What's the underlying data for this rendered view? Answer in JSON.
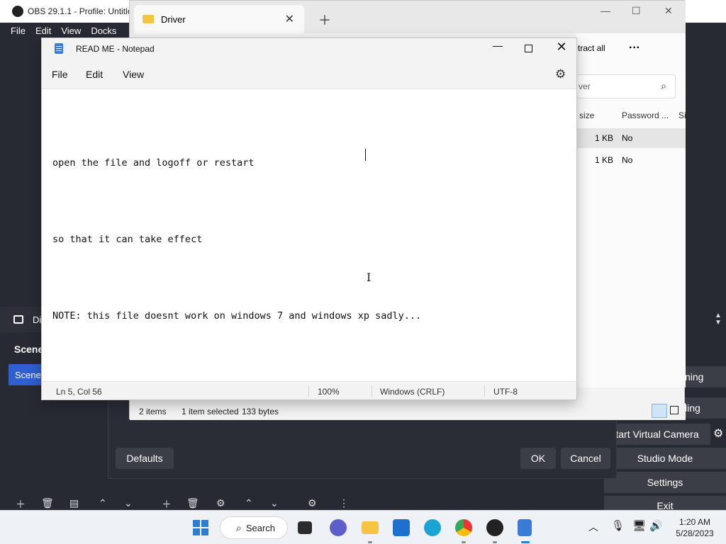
{
  "obs": {
    "title": "OBS 29.1.1 - Profile: Untitle",
    "menu": [
      "File",
      "Edit",
      "View",
      "Docks"
    ],
    "source_label": "Di",
    "scenes_label": "Scene",
    "scene_item": "Scene",
    "controls": {
      "virtual_camera": "tart Virtual Camera",
      "studio_mode": "Studio Mode",
      "settings": "Settings",
      "exit": "Exit",
      "streaming": "ning",
      "recording": "ling"
    },
    "dialog": {
      "defaults": "Defaults",
      "ok": "OK",
      "cancel": "Cancel"
    }
  },
  "explorer": {
    "tab_title": "Driver",
    "extract": "tract all",
    "search_placeholder": "ver",
    "columns": {
      "size": "size",
      "password": "Password ...",
      "extra": "Si"
    },
    "rows": [
      {
        "size": "1 KB",
        "password": "No"
      },
      {
        "size": "1 KB",
        "password": "No"
      }
    ],
    "status": {
      "items": "2 items",
      "selected": "1 item selected",
      "bytes": "133 bytes"
    }
  },
  "notepad": {
    "title": "READ ME - Notepad",
    "menu": {
      "file": "File",
      "edit": "Edit",
      "view": "View"
    },
    "lines": [
      "open the file and logoff or restart",
      "",
      "so that it can take effect",
      "",
      "NOTE: this file doesnt work on windows 7 and windows xp sadly..."
    ],
    "status": {
      "position": "Ln 5, Col 56",
      "zoom": "100%",
      "line_ending": "Windows (CRLF)",
      "encoding": "UTF-8"
    }
  },
  "taskbar": {
    "search_label": "Search",
    "time": "1:20 AM",
    "date": "5/28/2023"
  }
}
